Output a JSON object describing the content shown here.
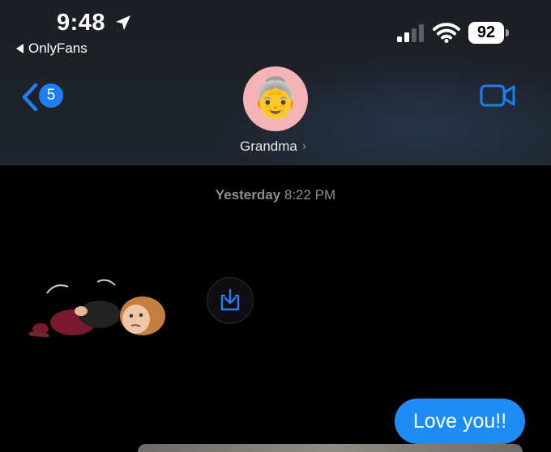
{
  "status_bar": {
    "time": "9:48",
    "back_app": "OnlyFans",
    "battery_level": "92"
  },
  "nav": {
    "back_badge_count": "5",
    "contact_name": "Grandma",
    "avatar_emoji": "👵",
    "accent_color": "#1f7ef0"
  },
  "conversation": {
    "timestamp_day": "Yesterday",
    "timestamp_time": "8:22 PM",
    "messages": [
      {
        "type": "sticker",
        "from": "contact",
        "icon": "memoji-sticker"
      },
      {
        "type": "text",
        "from": "me",
        "text": "Love you!!"
      }
    ]
  },
  "icons": [
    "location-arrow-icon",
    "signal-icon",
    "wifi-icon",
    "battery-icon",
    "back-chevron-icon",
    "video-camera-icon",
    "download-icon",
    "chevron-right-icon"
  ]
}
